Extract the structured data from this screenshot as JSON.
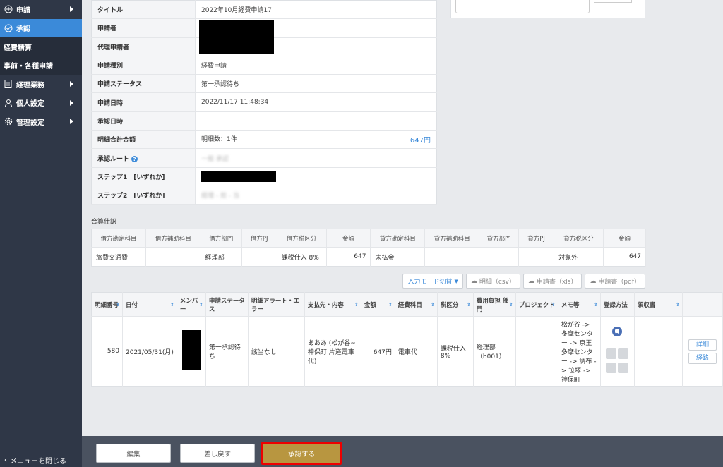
{
  "sidebar": {
    "items": [
      {
        "label": "申請",
        "icon": "plus-circle-icon"
      },
      {
        "label": "承認",
        "icon": "check-circle-icon"
      },
      {
        "label": "経費精算"
      },
      {
        "label": "事前・各種申請"
      },
      {
        "label": "経理業務",
        "icon": "document-icon"
      },
      {
        "label": "個人設定",
        "icon": "person-icon"
      },
      {
        "label": "管理設定",
        "icon": "gear-icon"
      }
    ],
    "close_label": "メニューを閉じる"
  },
  "info": {
    "rows": [
      {
        "label": "タイトル",
        "value": "2022年10月経費申請17"
      },
      {
        "label": "申請者",
        "value": ""
      },
      {
        "label": "代理申請者",
        "value": ""
      },
      {
        "label": "申請種別",
        "value": "経費申請"
      },
      {
        "label": "申請ステータス",
        "value": "第一承認待ち"
      },
      {
        "label": "申請日時",
        "value": "2022/11/17 11:48:34"
      },
      {
        "label": "承認日時",
        "value": ""
      },
      {
        "label": "明細合計金額",
        "value": "明細数：1件",
        "amount": "647円"
      },
      {
        "label": "承認ルート",
        "value": "一般 承認"
      },
      {
        "label": "ステップ1　[いずれか]",
        "value": ""
      },
      {
        "label": "ステップ2　[いずれか]",
        "value": "経理 - 担 - 当"
      }
    ]
  },
  "journal": {
    "title": "合算仕訳",
    "headers": [
      "借方勘定科目",
      "借方補助科目",
      "借方部門",
      "借方PJ",
      "借方税区分",
      "金額",
      "貸方勘定科目",
      "貸方補助科目",
      "貸方部門",
      "貸方PJ",
      "貸方税区分",
      "金額"
    ],
    "row": [
      "旅費交通費",
      "",
      "経理部",
      "",
      "課税仕入 8%",
      "647",
      "未払金",
      "",
      "",
      "",
      "対象外",
      "647"
    ]
  },
  "toolbar": {
    "mode_label": "入力モード切替",
    "csv_label": "明細（csv）",
    "xls_label": "申請書（xls）",
    "pdf_label": "申請書（pdf）"
  },
  "details": {
    "headers": [
      "明細番号",
      "日付",
      "メンバー",
      "申請ステータス",
      "明細アラート・エラー",
      "支払先・内容",
      "金額",
      "経費科目",
      "税区分",
      "費用負担 部門",
      "プロジェクト",
      "メモ等",
      "登録方法",
      "領収書"
    ],
    "row": {
      "no": "580",
      "date": "2021/05/31(月)",
      "status": "第一承認待ち",
      "alert": "該当なし",
      "payee": "あああ (松が谷~神保町 片道電車代)",
      "amount": "647円",
      "category": "電車代",
      "tax": "課税仕入8%",
      "dept": "経理部（b001）",
      "project": "",
      "memo": "松が谷 -> 多摩センター -> 京王多摩センター -> 調布 -> 笹塚 -> 神保町",
      "detail_label": "詳細",
      "route_label": "経路"
    }
  },
  "bottom": {
    "edit_label": "編集",
    "return_label": "差し戻す",
    "approve_label": "承認する"
  }
}
